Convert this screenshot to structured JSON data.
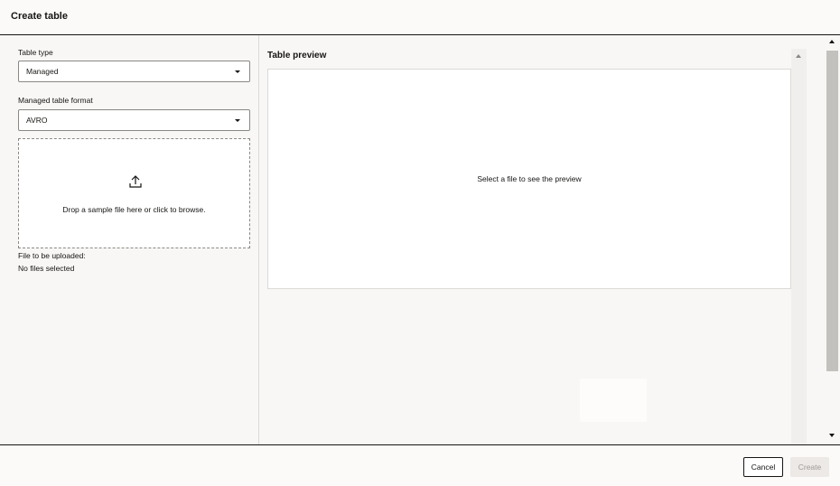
{
  "dialog": {
    "title": "Create table"
  },
  "form": {
    "table_type": {
      "label": "Table type",
      "value": "Managed"
    },
    "managed_table_format": {
      "label": "Managed table format",
      "value": "AVRO"
    },
    "dropzone": {
      "icon": "upload-icon",
      "text": "Drop a sample file here or click to browse."
    },
    "file_upload": {
      "label": "File to be uploaded:",
      "status": "No files selected"
    }
  },
  "preview": {
    "title": "Table preview",
    "empty_message": "Select a file to see the preview"
  },
  "footer": {
    "cancel_label": "Cancel",
    "create_label": "Create"
  },
  "colors": {
    "text": "#161513",
    "background": "#f8f7f5",
    "disabled_text": "#9e9b97",
    "disabled_bg": "#ece9e6"
  }
}
